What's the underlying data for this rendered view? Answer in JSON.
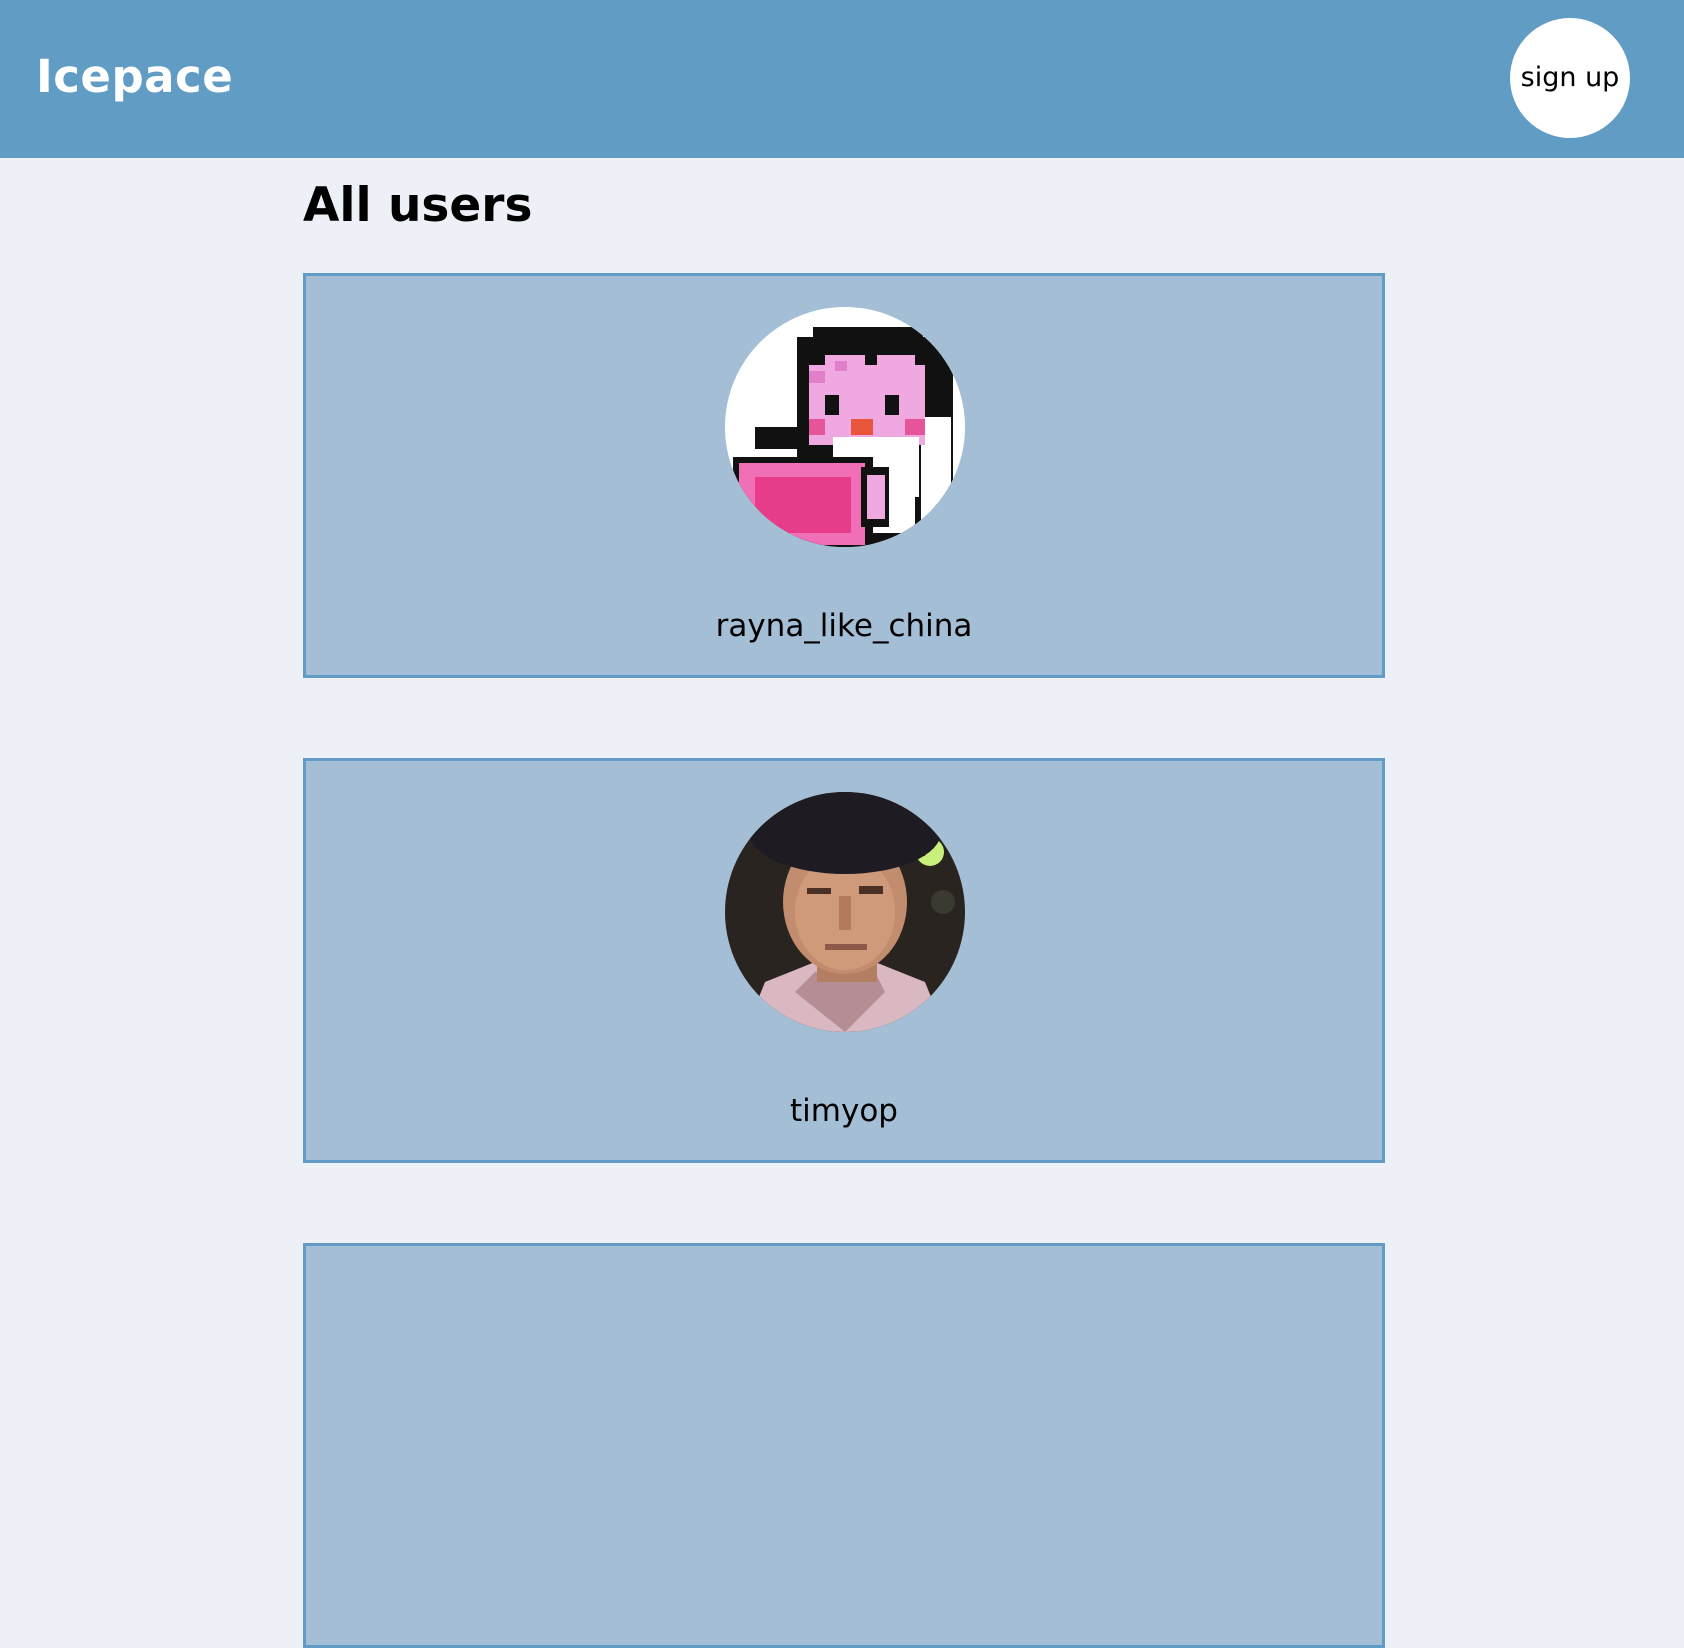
{
  "header": {
    "brand": "Icepace",
    "signup_label": "sign up"
  },
  "main": {
    "title": "All users",
    "users": [
      {
        "username": "rayna_like_china",
        "avatar_icon": "pixel-penguin-avatar"
      },
      {
        "username": "timyop",
        "avatar_icon": "man-photo-avatar"
      },
      {
        "username": ""
      }
    ]
  },
  "colors": {
    "header_bg": "#619cc4",
    "page_bg": "#edf0f7",
    "card_bg": "#a4bfd5",
    "card_border": "#629bc5"
  }
}
